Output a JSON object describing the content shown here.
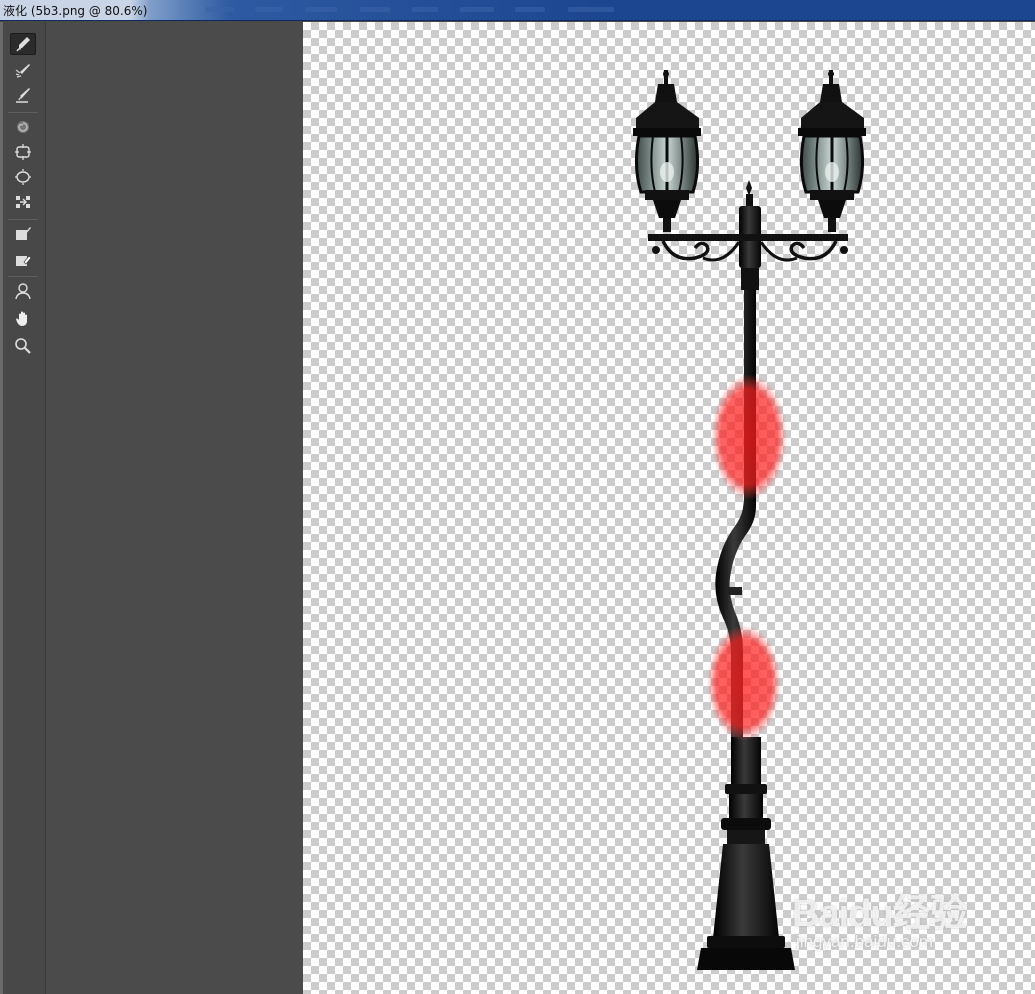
{
  "window": {
    "title": "液化 (5b3.png @ 80.6%)"
  },
  "tools": [
    {
      "name": "forward-warp-tool-icon",
      "active": true
    },
    {
      "name": "reconstruct-tool-icon",
      "active": false
    },
    {
      "name": "smooth-tool-icon",
      "active": false
    },
    {
      "name": "twirl-clockwise-tool-icon",
      "active": false
    },
    {
      "name": "pucker-tool-icon",
      "active": false
    },
    {
      "name": "bloat-tool-icon",
      "active": false
    },
    {
      "name": "push-left-tool-icon",
      "active": false
    },
    {
      "name": "freeze-mask-tool-icon",
      "active": false
    },
    {
      "name": "thaw-mask-tool-icon",
      "active": false
    },
    {
      "name": "face-tool-icon",
      "active": false
    },
    {
      "name": "hand-tool-icon",
      "active": false
    },
    {
      "name": "zoom-tool-icon",
      "active": false
    }
  ],
  "watermark": {
    "text": "Baidu经验",
    "subtext": "jingyan.baidu.com"
  },
  "colors": {
    "title_bar": "#1d4690",
    "panel": "#484848",
    "freeze_mask": "#ff2020",
    "lamp": "#111111"
  }
}
